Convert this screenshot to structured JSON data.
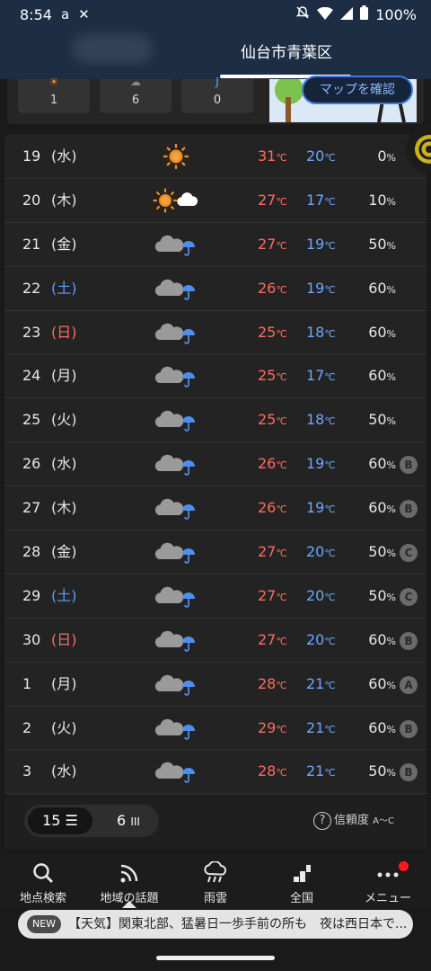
{
  "status_bar": {
    "time": "8:54",
    "battery": "100%",
    "icons": [
      "amazon-icon",
      "x-icon",
      "mute-icon",
      "wifi-icon",
      "signal-icon",
      "battery-icon"
    ]
  },
  "header": {
    "title": "仙台市青葉区"
  },
  "top_card": {
    "mini_values": [
      "1",
      "6",
      "0"
    ],
    "map_button": "マップを確認"
  },
  "forecast": {
    "temp_unit": "℃",
    "pop_unit": "%",
    "rows": [
      {
        "date": "19",
        "weekday": "(水)",
        "day_type": "weekday",
        "icon": "sunny",
        "high": "31",
        "low": "20",
        "pop": "0",
        "reliability": ""
      },
      {
        "date": "20",
        "weekday": "(木)",
        "day_type": "weekday",
        "icon": "sunny-then-cloudy",
        "high": "27",
        "low": "17",
        "pop": "10",
        "reliability": ""
      },
      {
        "date": "21",
        "weekday": "(金)",
        "day_type": "weekday",
        "icon": "cloudy-with-rain",
        "high": "27",
        "low": "19",
        "pop": "50",
        "reliability": ""
      },
      {
        "date": "22",
        "weekday": "(土)",
        "day_type": "saturday",
        "icon": "cloudy-with-rain",
        "high": "26",
        "low": "19",
        "pop": "60",
        "reliability": ""
      },
      {
        "date": "23",
        "weekday": "(日)",
        "day_type": "sunday",
        "icon": "cloudy-with-rain",
        "high": "25",
        "low": "18",
        "pop": "60",
        "reliability": ""
      },
      {
        "date": "24",
        "weekday": "(月)",
        "day_type": "weekday",
        "icon": "cloudy-with-rain",
        "high": "25",
        "low": "17",
        "pop": "60",
        "reliability": ""
      },
      {
        "date": "25",
        "weekday": "(火)",
        "day_type": "weekday",
        "icon": "cloudy-with-rain",
        "high": "25",
        "low": "18",
        "pop": "50",
        "reliability": ""
      },
      {
        "date": "26",
        "weekday": "(水)",
        "day_type": "weekday",
        "icon": "cloudy-with-rain",
        "high": "26",
        "low": "19",
        "pop": "60",
        "reliability": "B"
      },
      {
        "date": "27",
        "weekday": "(木)",
        "day_type": "weekday",
        "icon": "cloudy-with-rain",
        "high": "26",
        "low": "19",
        "pop": "60",
        "reliability": "B"
      },
      {
        "date": "28",
        "weekday": "(金)",
        "day_type": "weekday",
        "icon": "cloudy-with-rain",
        "high": "27",
        "low": "20",
        "pop": "50",
        "reliability": "C"
      },
      {
        "date": "29",
        "weekday": "(土)",
        "day_type": "saturday",
        "icon": "cloudy-with-rain",
        "high": "27",
        "low": "20",
        "pop": "50",
        "reliability": "C"
      },
      {
        "date": "30",
        "weekday": "(日)",
        "day_type": "sunday",
        "icon": "cloudy-with-rain",
        "high": "27",
        "low": "20",
        "pop": "60",
        "reliability": "B"
      },
      {
        "date": "1",
        "weekday": "(月)",
        "day_type": "weekday",
        "icon": "cloudy-with-rain",
        "high": "28",
        "low": "21",
        "pop": "60",
        "reliability": "A"
      },
      {
        "date": "2",
        "weekday": "(火)",
        "day_type": "weekday",
        "icon": "cloudy-with-rain",
        "high": "29",
        "low": "21",
        "pop": "60",
        "reliability": "B"
      },
      {
        "date": "3",
        "weekday": "(水)",
        "day_type": "weekday",
        "icon": "cloudy-with-rain",
        "high": "28",
        "low": "21",
        "pop": "50",
        "reliability": "B"
      }
    ]
  },
  "controls": {
    "toggle_15_label": "15",
    "toggle_6_label": "6",
    "selected": "15",
    "reliability_label": "信頼度",
    "reliability_range": "A〜C"
  },
  "nav": {
    "items": [
      {
        "label": "地点検索",
        "icon": "search-icon"
      },
      {
        "label": "地域の話題",
        "icon": "rss-icon",
        "active": true
      },
      {
        "label": "雨雲",
        "icon": "rain-cloud-icon"
      },
      {
        "label": "全国",
        "icon": "bars-icon"
      },
      {
        "label": "メニュー",
        "icon": "dots-icon",
        "notification": true
      }
    ]
  },
  "ticker": {
    "badge": "NEW",
    "text": "【天気】関東北部、猛暑日一歩手前の所も　夜は西日本で..."
  },
  "colors": {
    "header_bg": "#1d2d44",
    "high_temp": "#ff6b5e",
    "low_temp": "#6aa8ff",
    "saturday": "#5aa0ff",
    "sunday": "#ff6a6a",
    "accent_blue": "#3b7be0",
    "notification": "#ff1a1a"
  }
}
